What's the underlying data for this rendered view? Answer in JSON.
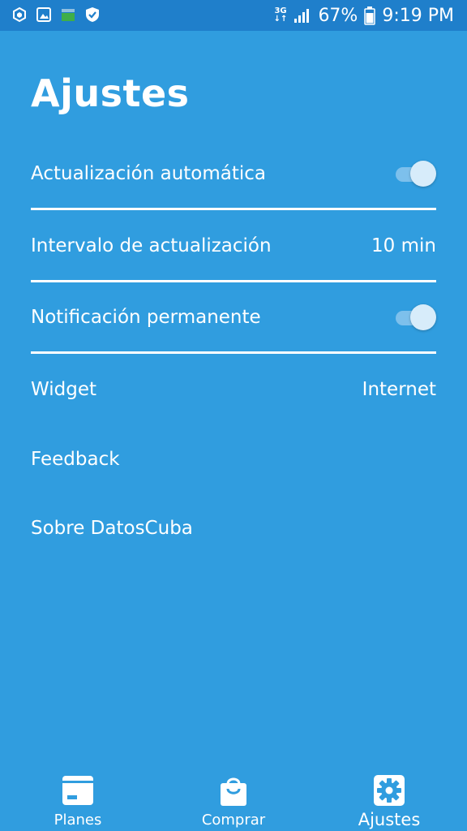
{
  "status_bar": {
    "network_top": "3G",
    "network_bottom": "↓↑",
    "battery_percent": "67%",
    "time": "9:19 PM"
  },
  "page": {
    "title": "Ajustes"
  },
  "settings": {
    "auto_update": {
      "label": "Actualización automática",
      "enabled": true
    },
    "update_interval": {
      "label": "Intervalo de actualización",
      "value": "10 min"
    },
    "permanent_notification": {
      "label": "Notificación permanente",
      "enabled": true
    },
    "widget": {
      "label": "Widget",
      "value": "Internet"
    },
    "feedback": {
      "label": "Feedback"
    },
    "about": {
      "label": "Sobre DatosCuba"
    }
  },
  "bottom_nav": {
    "items": [
      {
        "label": "Planes",
        "icon": "card-icon"
      },
      {
        "label": "Comprar",
        "icon": "shopping-bag-icon"
      },
      {
        "label": "Ajustes",
        "icon": "gear-icon",
        "active": true
      }
    ]
  },
  "colors": {
    "background": "#309ddf",
    "status_bar": "#1f7fcb",
    "toggle_track": "#7dc0ec",
    "toggle_thumb": "#d7ecfa"
  }
}
